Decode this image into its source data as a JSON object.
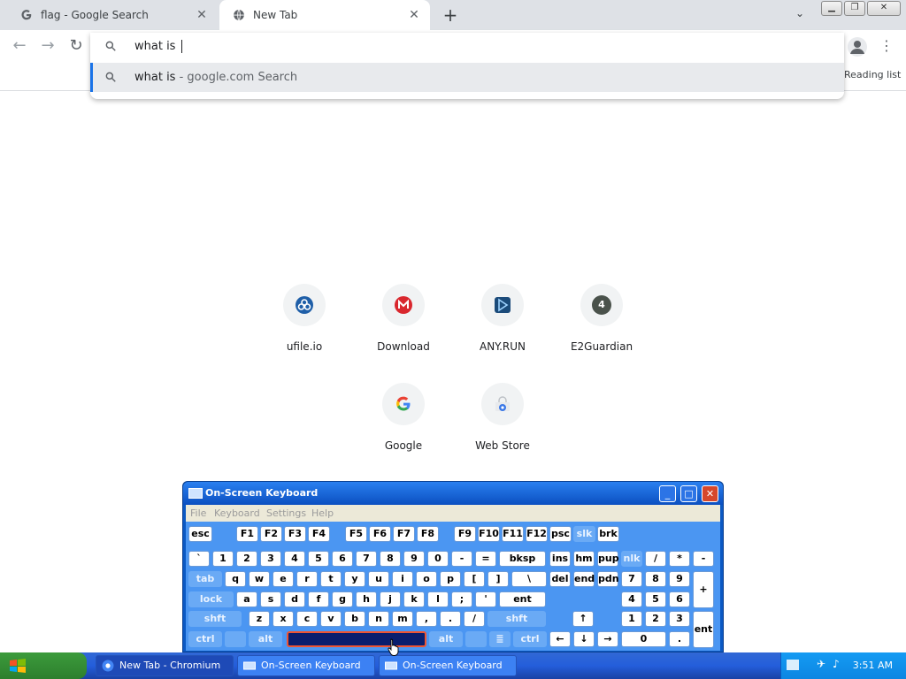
{
  "tabs": [
    {
      "title": "flag - Google Search",
      "active": false
    },
    {
      "title": "New Tab",
      "active": true
    }
  ],
  "omnibox": {
    "value": "what is",
    "suggestion_main": "what is",
    "suggestion_sub": " - google.com Search"
  },
  "toolbar": {
    "reading_list": "Reading list"
  },
  "shortcuts": [
    {
      "label": "ufile.io",
      "icon": "ufile-icon"
    },
    {
      "label": "Download",
      "icon": "mega-icon"
    },
    {
      "label": "ANY.RUN",
      "icon": "anyrun-icon"
    },
    {
      "label": "E2Guardian",
      "icon": "letter-4-icon",
      "letter": "4"
    },
    {
      "label": "Google",
      "icon": "google-icon"
    },
    {
      "label": "Web Store",
      "icon": "webstore-icon"
    }
  ],
  "osk": {
    "title": "On-Screen Keyboard",
    "menu": [
      "File",
      "Keyboard",
      "Settings",
      "Help"
    ],
    "rows": {
      "r1": [
        "esc",
        "F1",
        "F2",
        "F3",
        "F4",
        "F5",
        "F6",
        "F7",
        "F8",
        "F9",
        "F10",
        "F11",
        "F12",
        "psc",
        "slk",
        "brk"
      ],
      "r2": [
        "`",
        "1",
        "2",
        "3",
        "4",
        "5",
        "6",
        "7",
        "8",
        "9",
        "0",
        "-",
        "=",
        "bksp",
        "ins",
        "hm",
        "pup",
        "nlk",
        "/",
        "*",
        "-"
      ],
      "r3": [
        "tab",
        "q",
        "w",
        "e",
        "r",
        "t",
        "y",
        "u",
        "i",
        "o",
        "p",
        "[",
        "]",
        "\\",
        "del",
        "end",
        "pdn",
        "7",
        "8",
        "9",
        "+"
      ],
      "r4": [
        "lock",
        "a",
        "s",
        "d",
        "f",
        "g",
        "h",
        "j",
        "k",
        "l",
        ";",
        "'",
        "ent",
        "4",
        "5",
        "6"
      ],
      "r5": [
        "shft",
        "z",
        "x",
        "c",
        "v",
        "b",
        "n",
        "m",
        ",",
        ".",
        "/",
        "shft",
        "↑",
        "1",
        "2",
        "3",
        "ent"
      ],
      "r6": [
        "ctrl",
        "alt",
        "alt",
        "ctrl",
        "←",
        "↓",
        "→",
        "0",
        "."
      ]
    }
  },
  "taskbar": {
    "items": [
      "New Tab - Chromium",
      "On-Screen Keyboard",
      "On-Screen Keyboard"
    ],
    "clock": "3:51 AM"
  }
}
